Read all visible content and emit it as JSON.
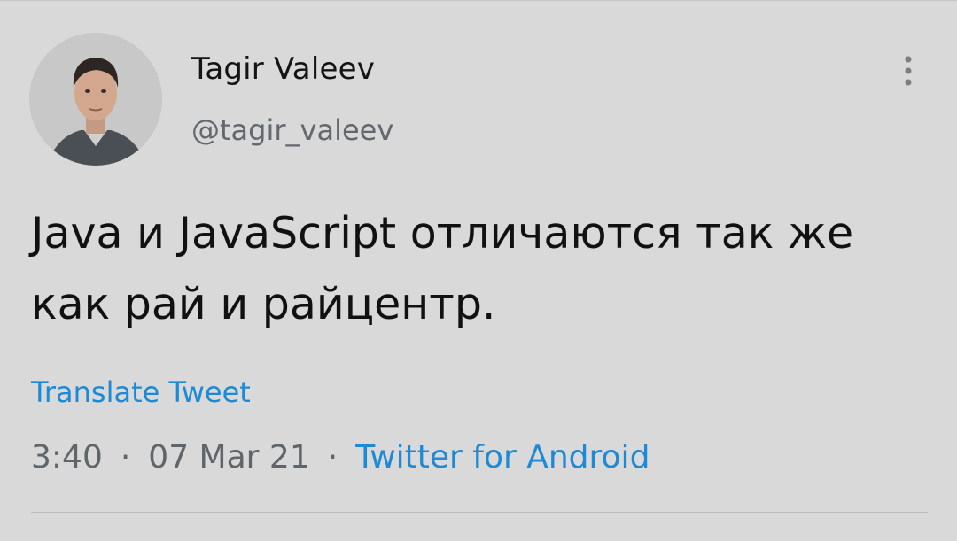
{
  "author": {
    "display_name": "Tagir Valeev",
    "handle": "@tagir_valeev"
  },
  "tweet": {
    "text": "Java и JavaScript отличаются так же как рай и райцентр.",
    "translate_label": "Translate Tweet"
  },
  "meta": {
    "time": "3:40",
    "separator": "·",
    "date": "07 Mar 21",
    "source": "Twitter for Android"
  },
  "icons": {
    "more": "more-vertical-icon",
    "avatar": "profile-photo"
  },
  "colors": {
    "background": "#d9d9d9",
    "link": "#1c8ad6",
    "text": "#111111",
    "secondary": "#62686d"
  }
}
